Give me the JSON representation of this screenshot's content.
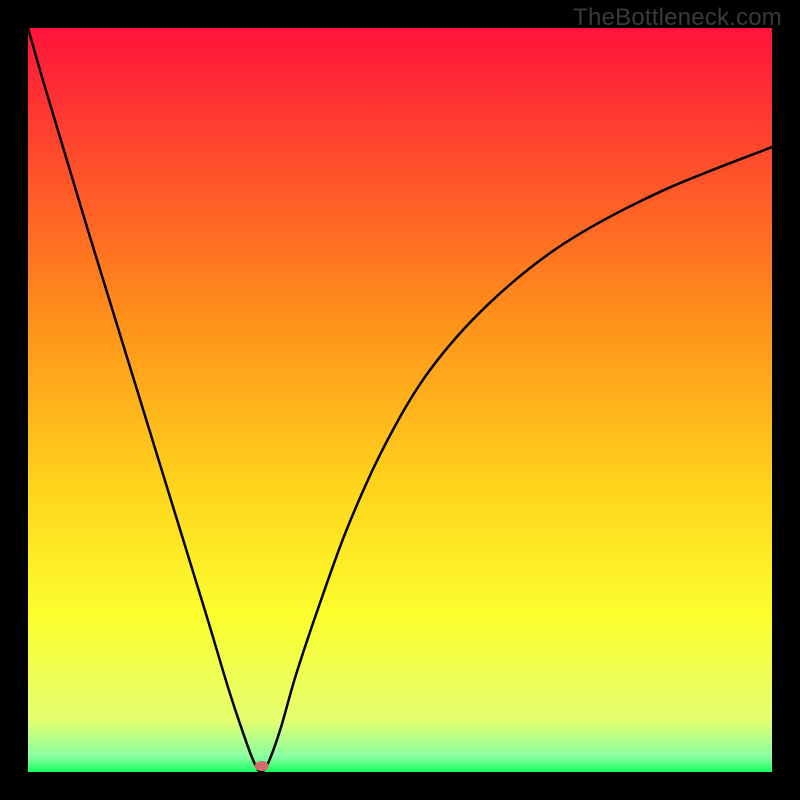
{
  "watermark": "TheBottleneck.com",
  "chart_data": {
    "type": "line",
    "title": "",
    "xlabel": "",
    "ylabel": "",
    "xlim": [
      0,
      100
    ],
    "ylim": [
      0,
      100
    ],
    "axes_hidden": true,
    "gradient_stops": [
      {
        "offset": 0.0,
        "color": "#ff133b"
      },
      {
        "offset": 0.38,
        "color": "#ff8d1b"
      },
      {
        "offset": 0.62,
        "color": "#ffd51c"
      },
      {
        "offset": 0.79,
        "color": "#fcff2e"
      },
      {
        "offset": 0.93,
        "color": "#e5ff70"
      },
      {
        "offset": 0.98,
        "color": "#88ffa2"
      },
      {
        "offset": 1.0,
        "color": "#16ff5d"
      }
    ],
    "curve": {
      "x": [
        0,
        2,
        5,
        8,
        12,
        16,
        20,
        24,
        27,
        29,
        30.3,
        31.3,
        32.4,
        34,
        36,
        39,
        43,
        48,
        54,
        62,
        72,
        85,
        100
      ],
      "y": [
        100,
        93,
        83,
        73,
        60,
        47,
        34,
        21,
        11,
        5,
        1.5,
        0,
        1.5,
        6,
        13,
        22,
        33,
        44,
        54,
        63,
        71,
        78,
        84
      ]
    },
    "marker": {
      "x": 31.4,
      "y": 0.8,
      "color": "#d66a6f"
    }
  }
}
